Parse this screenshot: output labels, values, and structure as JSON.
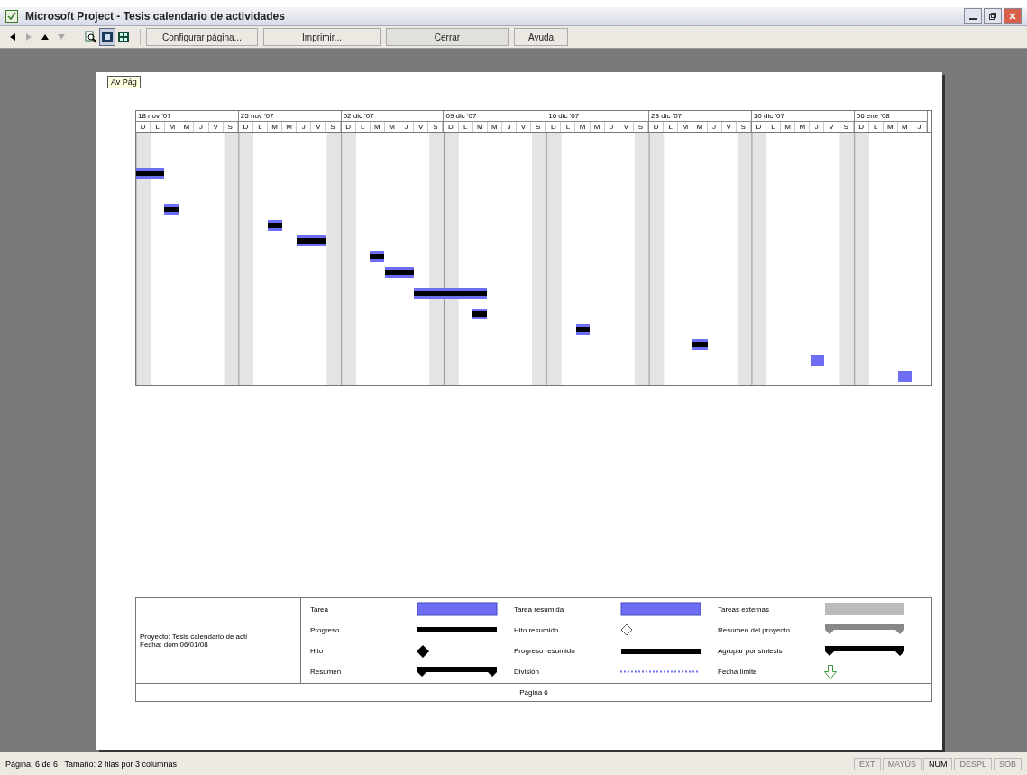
{
  "window": {
    "title": "Microsoft Project - Tesis calendario de actividades"
  },
  "toolbar": {
    "nav_buttons": [
      {
        "kind": "left",
        "disabled": false
      },
      {
        "kind": "right",
        "disabled": true
      },
      {
        "kind": "up",
        "disabled": false
      },
      {
        "kind": "down",
        "disabled": true
      }
    ],
    "view_buttons": [
      {
        "kind": "zoom",
        "selected": false
      },
      {
        "kind": "single",
        "selected": true
      },
      {
        "kind": "multi",
        "selected": false
      }
    ],
    "buttons": [
      "Configurar página...",
      "Imprimir...",
      "Cerrar",
      "Ayuda"
    ]
  },
  "tooltip": "Av Pág",
  "timescale": [
    {
      "label": "18 nov '07",
      "days": [
        "D",
        "L",
        "M",
        "M",
        "J",
        "V",
        "S"
      ]
    },
    {
      "label": "25 nov '07",
      "days": [
        "D",
        "L",
        "M",
        "M",
        "J",
        "V",
        "S"
      ]
    },
    {
      "label": "02 dic '07",
      "days": [
        "D",
        "L",
        "M",
        "M",
        "J",
        "V",
        "S"
      ]
    },
    {
      "label": "09 dic '07",
      "days": [
        "D",
        "L",
        "M",
        "M",
        "J",
        "V",
        "S"
      ]
    },
    {
      "label": "16 dic '07",
      "days": [
        "D",
        "L",
        "M",
        "M",
        "J",
        "V",
        "S"
      ]
    },
    {
      "label": "23 dic '07",
      "days": [
        "D",
        "L",
        "M",
        "M",
        "J",
        "V",
        "S"
      ]
    },
    {
      "label": "30 dic '07",
      "days": [
        "D",
        "L",
        "M",
        "M",
        "J",
        "V",
        "S"
      ]
    },
    {
      "label": "06 ene '08",
      "days": [
        "D",
        "L",
        "M",
        "M",
        "J"
      ]
    }
  ],
  "legend": {
    "project_info": [
      "Proyecto: Tesis calendario de acti",
      "Fecha: dom 06/01/08"
    ],
    "columns": [
      [
        {
          "label": "Tarea",
          "kind": "task"
        },
        {
          "label": "Progreso",
          "kind": "progress"
        },
        {
          "label": "Hito",
          "kind": "milestone"
        },
        {
          "label": "Resumen",
          "kind": "summary"
        }
      ],
      [
        {
          "label": "Tarea resumida",
          "kind": "task"
        },
        {
          "label": "Hito resumido",
          "kind": "hollow-milestone"
        },
        {
          "label": "Progreso resumido",
          "kind": "progress"
        },
        {
          "label": "División",
          "kind": "split"
        }
      ],
      [
        {
          "label": "Tareas externas",
          "kind": "external"
        },
        {
          "label": "Resumen del proyecto",
          "kind": "project-summary"
        },
        {
          "label": "Agrupar por síntesis",
          "kind": "summary"
        },
        {
          "label": "Fecha límite",
          "kind": "deadline"
        }
      ]
    ]
  },
  "footer": "Página 6",
  "status_bar": {
    "text": "Página: 6 de 6   Tamaño: 2 filas por 3 columnas",
    "indicators": [
      {
        "label": "EXT",
        "on": false
      },
      {
        "label": "MAYÚS",
        "on": false
      },
      {
        "label": "NUM",
        "on": true
      },
      {
        "label": "DESPL",
        "on": false
      },
      {
        "label": "SOB",
        "on": false
      }
    ]
  }
}
